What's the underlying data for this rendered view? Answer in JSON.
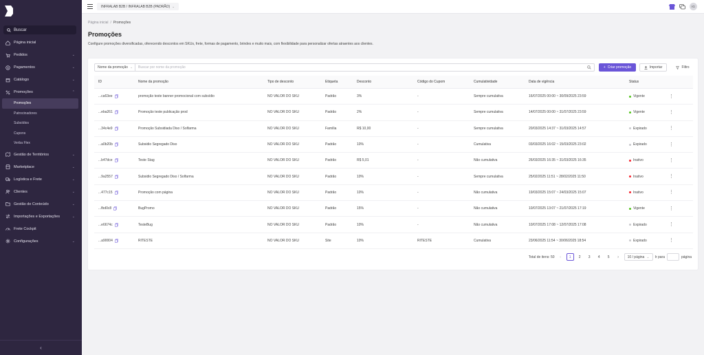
{
  "sidebar": {
    "search_label": "Buscar",
    "items": [
      {
        "label": "Página inicial",
        "icon": "home-icon",
        "has_children": false
      },
      {
        "label": "Pedidos",
        "icon": "cart-icon",
        "has_children": true
      },
      {
        "label": "Pagamentos",
        "icon": "dollar-icon",
        "has_children": true
      },
      {
        "label": "Catálogo",
        "icon": "box-icon",
        "has_children": true
      },
      {
        "label": "Promoções",
        "icon": "percent-icon",
        "has_children": true,
        "expanded": true
      }
    ],
    "promo_sub_items": [
      {
        "label": "Promoções",
        "active": true
      },
      {
        "label": "Patrocinadores",
        "active": false
      },
      {
        "label": "Subsídios",
        "active": false
      },
      {
        "label": "Cupons",
        "active": false
      },
      {
        "label": "Verba Flex",
        "active": false
      }
    ],
    "items_after": [
      {
        "label": "Gestão de Territórios",
        "icon": "map-icon",
        "has_children": true
      },
      {
        "label": "Marketplace",
        "icon": "store-icon",
        "has_children": true
      },
      {
        "label": "Logística e Frete",
        "icon": "truck-icon",
        "has_children": true
      },
      {
        "label": "Clientes",
        "icon": "users-icon",
        "has_children": true
      },
      {
        "label": "Gestão de Conteúdo",
        "icon": "folder-icon",
        "has_children": true
      },
      {
        "label": "Importações e Exportações",
        "icon": "transfer-icon",
        "has_children": true
      },
      {
        "label": "Frete Cockpit",
        "icon": "cockpit-icon",
        "has_children": false
      },
      {
        "label": "Configurações",
        "icon": "gear-icon",
        "has_children": true
      }
    ]
  },
  "topbar": {
    "store_label": "INFRALAB B2B / INFRALAB B2B (PADRÃO)",
    "avatar_initials": "IG"
  },
  "breadcrumb": {
    "home": "Página inicial",
    "separator": "/",
    "current": "Promoções"
  },
  "page": {
    "title": "Promoções",
    "description": "Configure promoções diversificadas, oferecendo descontos em SKUs, frete, formas de pagamento, brindes e muito mais, com flexibilidade para personalizar ofertas atraentes aos clientes."
  },
  "toolbar": {
    "filter_field": "Nome da promoção",
    "search_placeholder": "Buscar por nome da promoção",
    "create_label": "Criar promoção",
    "import_label": "Importar",
    "filter_label": "Filtro"
  },
  "table": {
    "headers": {
      "id": "ID",
      "name": "Nome da promoção",
      "tipo": "Tipo de desconto",
      "etiqueta": "Etiqueta",
      "desconto": "Desconto",
      "cupom": "Código do Cupom",
      "cumulatividade": "Cumulatividade",
      "vigencia": "Data de vigência",
      "status": "Status"
    },
    "rows": [
      {
        "id": "...ca63ee",
        "name": "promoção teste banner promocional com subsídio",
        "tipo": "NO VALOR DO SKU",
        "etiqueta": "Padrão",
        "desconto": "3%",
        "cupom": "-",
        "cumulatividade": "Sempre cumulativa",
        "vigencia": "16/07/2025 00:00 ~ 30/09/2025 23:59",
        "status": "Vigente",
        "status_color": "#52c41a"
      },
      {
        "id": "...eba261",
        "name": "Promoção teste publicação prod",
        "tipo": "NO VALOR DO SKU",
        "etiqueta": "Padrão",
        "desconto": "2%",
        "cupom": "-",
        "cumulatividade": "Sempre cumulativa",
        "vigencia": "14/07/2025 00:00 ~ 31/07/2025 23:59",
        "status": "Vigente",
        "status_color": "#52c41a"
      },
      {
        "id": "...34c4e9",
        "name": "Promoção Subsidiada Diso / Solfarma",
        "tipo": "NO VALOR DO SKU",
        "etiqueta": "Família",
        "desconto": "R$ 10,00",
        "cupom": "-",
        "cumulatividade": "Sempre cumulativa",
        "vigencia": "20/03/2025 14:37 ~ 31/03/2025 14:57",
        "status": "Expirado",
        "status_color": "#c8c8cc"
      },
      {
        "id": "...a0b20b",
        "name": "Subsidio Segregado Diso",
        "tipo": "NO VALOR DO SKU",
        "etiqueta": "Padrão",
        "desconto": "10%",
        "cupom": "-",
        "cumulatividade": "Cumulativa",
        "vigencia": "03/03/2025 16:02 ~ 15/03/2025 23:02",
        "status": "Expirado",
        "status_color": "#c8c8cc"
      },
      {
        "id": "...b47dce",
        "name": "Teste Stag",
        "tipo": "NO VALOR DO SKU",
        "etiqueta": "Padrão",
        "desconto": "R$ 5,01",
        "cupom": "-",
        "cumulatividade": "Não cumulativa",
        "vigencia": "26/03/2025 16:35 ~ 31/03/2025 16:35",
        "status": "Inativo",
        "status_color": "#f5222d"
      },
      {
        "id": "...9a2557",
        "name": "Subsidio Segregado Diso / Solfarma",
        "tipo": "NO VALOR DO SKU",
        "etiqueta": "Padrão",
        "desconto": "10%",
        "cupom": "-",
        "cumulatividade": "Sempre cumulativa",
        "vigencia": "25/02/2025 11:51 ~ 28/02/2025 11:50",
        "status": "Inativo",
        "status_color": "#f5222d"
      },
      {
        "id": "...477c15",
        "name": "Promoção com página",
        "tipo": "NO VALOR DO SKU",
        "etiqueta": "Padrão",
        "desconto": "10%",
        "cupom": "-",
        "cumulatividade": "Não cumulativa",
        "vigencia": "19/03/2025 15:07 ~ 24/03/2025 15:07",
        "status": "Inativo",
        "status_color": "#f5222d"
      },
      {
        "id": "...fbd0c8",
        "name": "BugPromo",
        "tipo": "NO VALOR DO SKU",
        "etiqueta": "Padrão",
        "desconto": "15%",
        "cupom": "-",
        "cumulatividade": "Não cumulativa",
        "vigencia": "10/07/2025 13:07 ~ 21/07/2025 17:19",
        "status": "Vigente",
        "status_color": "#52c41a"
      },
      {
        "id": "...e6674c",
        "name": "TesteBug",
        "tipo": "NO VALOR DO SKU",
        "etiqueta": "Padrão",
        "desconto": "10%",
        "cupom": "-",
        "cumulatividade": "Não cumulativa",
        "vigencia": "10/07/2025 17:08 ~ 12/07/2025 17:08",
        "status": "Expirado",
        "status_color": "#c8c8cc"
      },
      {
        "id": "...a90004",
        "name": "RITESTE",
        "tipo": "NO VALOR DO SKU",
        "etiqueta": "Site",
        "desconto": "10%",
        "cupom": "RITESTE",
        "cumulatividade": "Cumulativa",
        "vigencia": "23/06/2025 11:54 ~ 30/06/2025 18:54",
        "status": "Expirado",
        "status_color": "#c8c8cc"
      }
    ]
  },
  "pagination": {
    "total_label": "Total de itens: 50",
    "pages": [
      "1",
      "2",
      "3",
      "4",
      "5"
    ],
    "current_page": "1",
    "page_size": "10 / página",
    "goto_label": "Ir para",
    "goto_suffix": "página"
  },
  "colors": {
    "accent": "#6a55d8",
    "sidebar_bg": "#2e2640"
  }
}
